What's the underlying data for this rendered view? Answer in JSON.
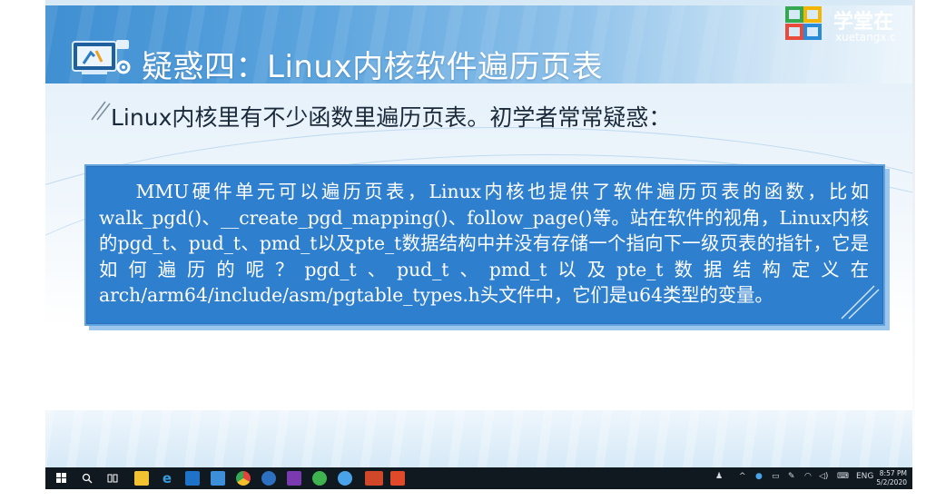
{
  "slide": {
    "title": "疑惑四：Linux内核软件遍历页表",
    "subtitle": "Linux内核里有不少函数里遍历页表。初学者常常疑惑：",
    "content": "MMU硬件单元可以遍历页表，Linux内核也提供了软件遍历页表的函数，比如walk_pgd()、__create_pgd_mapping()、follow_page()等。站在软件的视角，Linux内核的pgd_t、pud_t、pmd_t以及pte_t数据结构中并没有存储一个指向下一级页表的指针，它是如何遍历的呢？pgd_t、pud_t、pmd_t以及pte_t数据结构定义在arch/arm64/include/asm/pgtable_types.h头文件中，它们是u64类型的变量。"
  },
  "logo": {
    "cn": "学堂在",
    "en": "xuetangx.c"
  },
  "taskbar": {
    "icons": [
      "windows-start-icon",
      "search-icon",
      "task-view-icon",
      "file-explorer-icon",
      "edge-browser-icon",
      "outlook-icon",
      "photos-icon",
      "chrome-icon",
      "app-icon",
      "onenote-icon",
      "wechat-icon",
      "app-globe-icon",
      "powerpoint-icon",
      "video-app-icon"
    ],
    "tray_lang": "ENG",
    "time": "8:57 PM",
    "date": "5/2/2020"
  },
  "colors": {
    "accent": "#2f7fcf",
    "title_band": "#4a97d6",
    "taskbar": "#101820"
  }
}
